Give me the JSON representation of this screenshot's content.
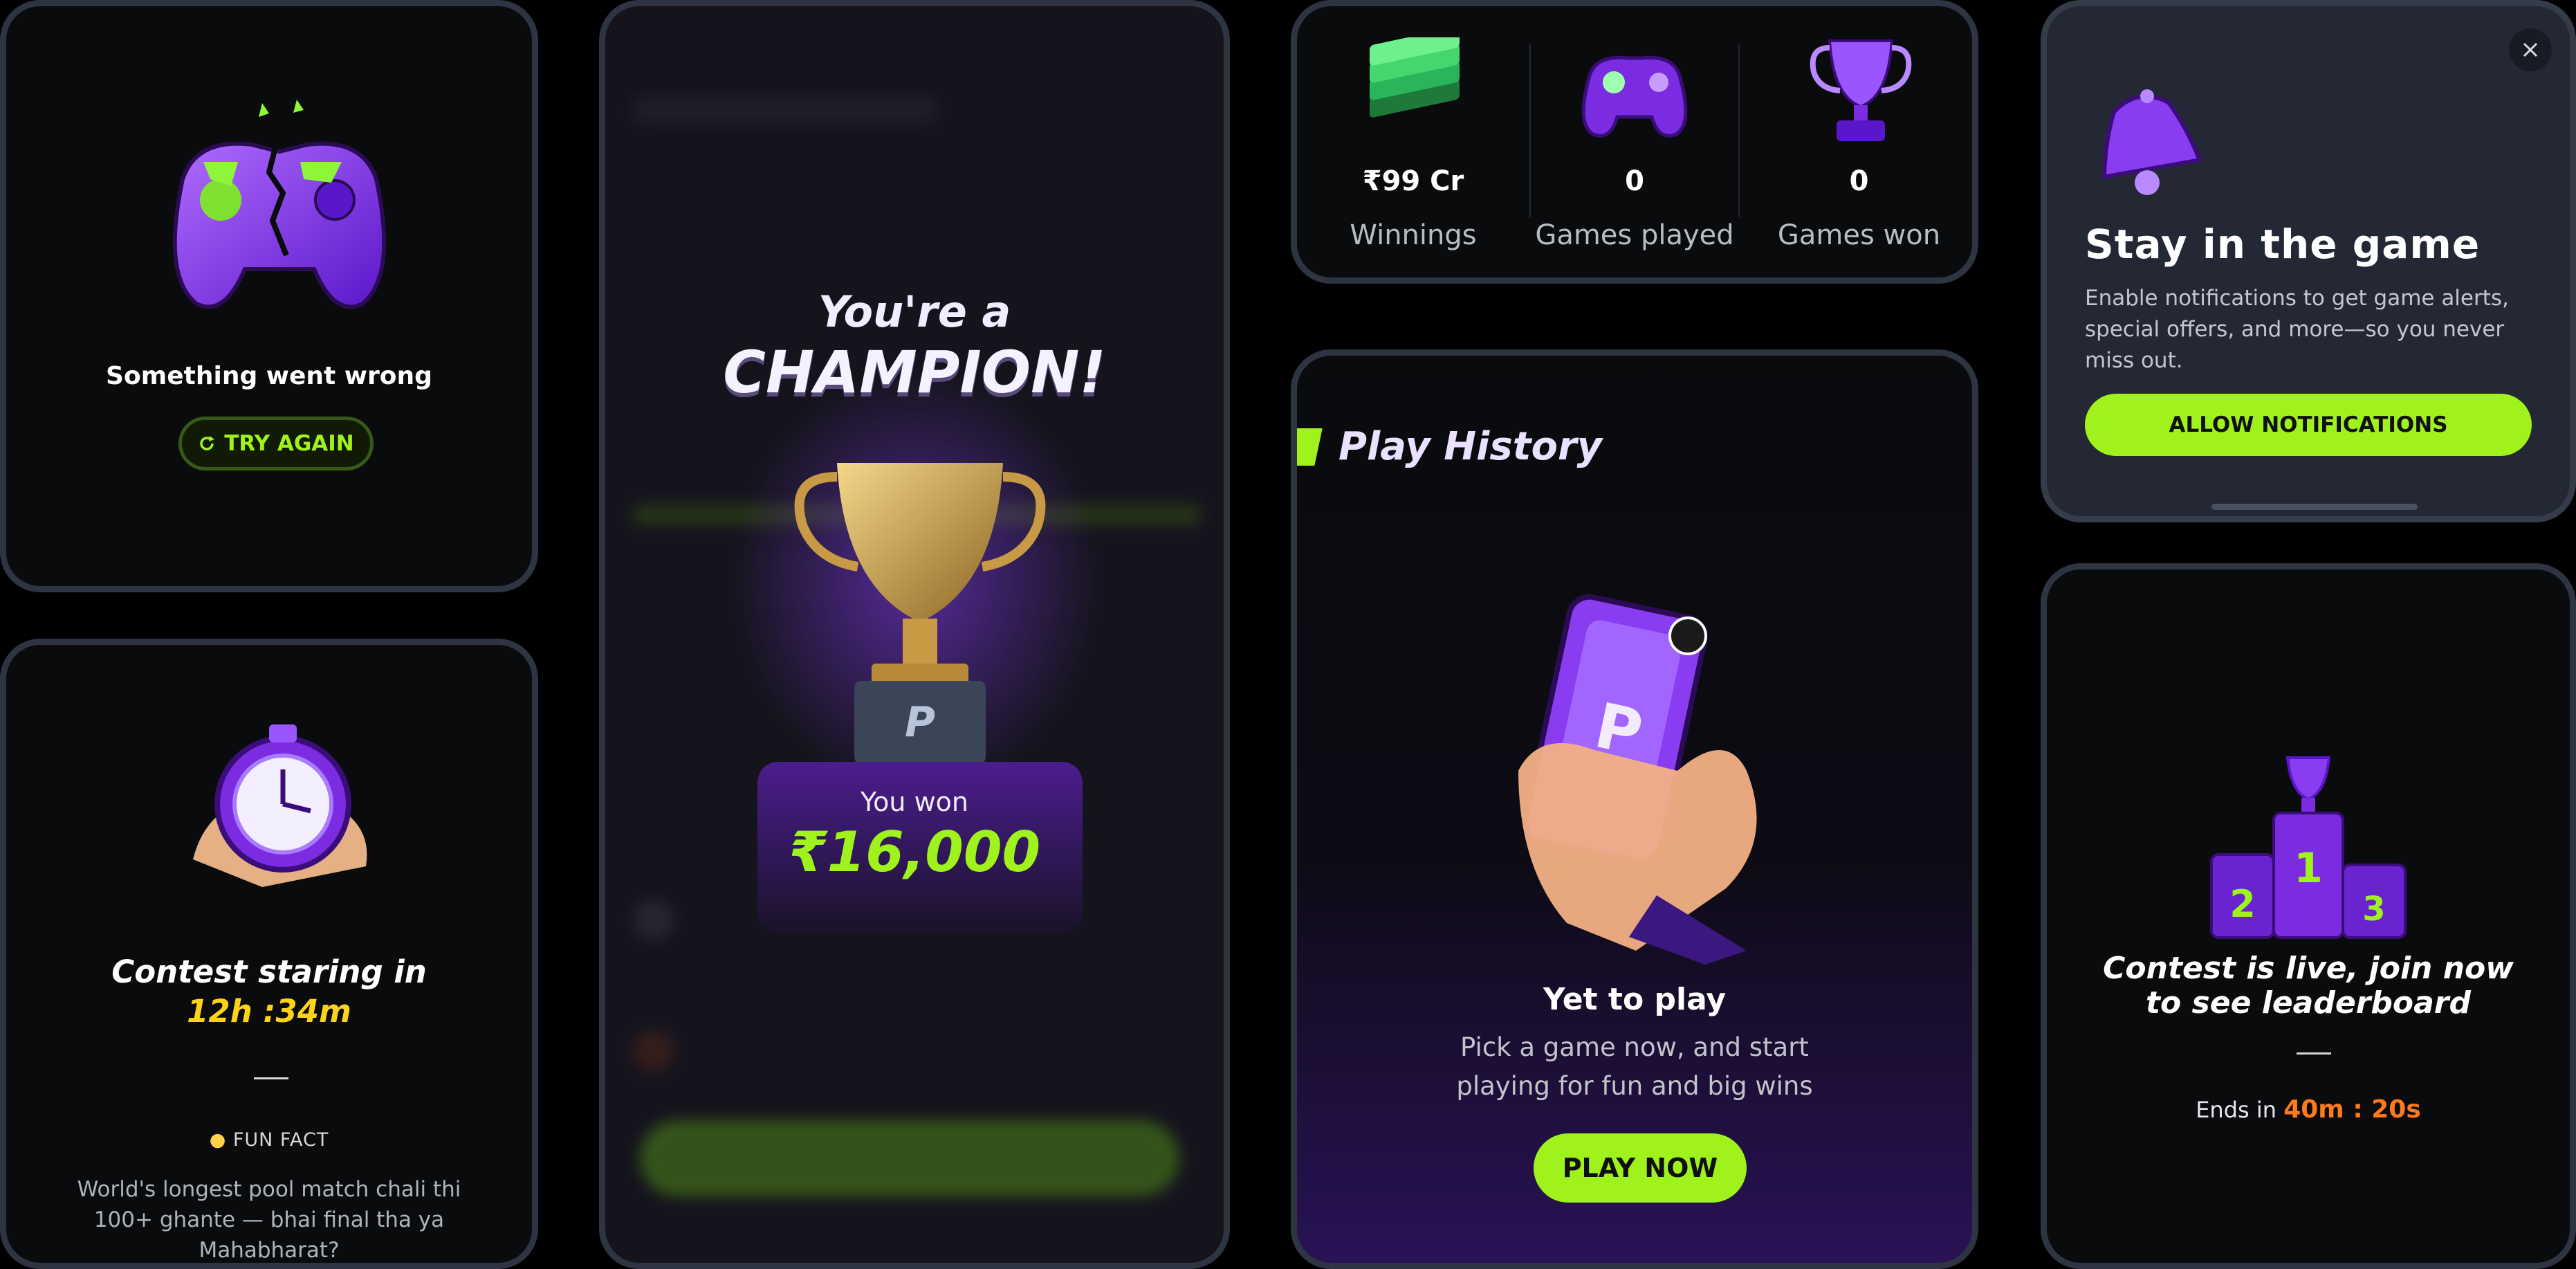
{
  "error_card": {
    "title": "Something went wrong",
    "retry_label": "TRY AGAIN",
    "retry_icon": "refresh-icon",
    "illustration": "broken-gamepad-icon"
  },
  "contest_card": {
    "title": "Contest staring in",
    "countdown": "12h :34m",
    "fun_fact_label": "FUN FACT",
    "fun_fact_icon": "lightbulb-icon",
    "fun_fact_text": "World's longest pool match chali thi 100+ ghante — bhai final tha ya Mahabharat?",
    "illustration": "stopwatch-icon"
  },
  "champion_card": {
    "line1": "You're a",
    "line2": "CHAMPION!",
    "won_label": "You won",
    "amount": "₹16,000",
    "illustration": "trophy-icon"
  },
  "stats": {
    "items": [
      {
        "icon": "money-stack-icon",
        "value": "₹99 Cr",
        "label": "Winnings"
      },
      {
        "icon": "gamepad-icon",
        "value": "0",
        "label": "Games played"
      },
      {
        "icon": "trophy-icon",
        "value": "0",
        "label": "Games won"
      }
    ]
  },
  "history": {
    "title": "Play History",
    "empty_title": "Yet to play",
    "empty_desc": "Pick a game now, and start playing for fun and big wins",
    "cta": "PLAY NOW",
    "illustration": "phone-in-hand-icon"
  },
  "notification_sheet": {
    "title": "Stay in the game",
    "desc": "Enable notifications to get game alerts, special offers, and more—so you never miss out.",
    "cta": "ALLOW NOTIFICATIONS",
    "close_icon": "close-icon",
    "illustration": "bell-icon"
  },
  "leaderboard_card": {
    "title": "Contest is live, join now to see leaderboard",
    "ends_label": "Ends in",
    "ends_value": "40m : 20s",
    "podium": [
      "2",
      "1",
      "3"
    ],
    "illustration": "podium-icon"
  },
  "colors": {
    "accent_green": "#a0f21c",
    "accent_purple": "#8b3df0",
    "countdown_yellow": "#ffd21a",
    "timer_orange": "#ff7a1a"
  }
}
